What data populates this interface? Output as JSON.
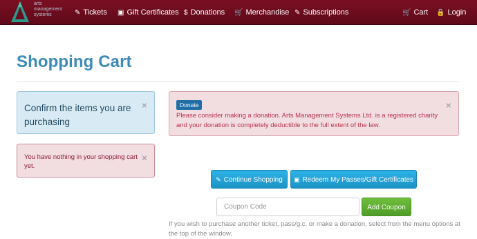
{
  "logo": {
    "alt": "Arts Management Systems",
    "lines": [
      "arts",
      "management",
      "systems"
    ]
  },
  "nav": {
    "items": [
      {
        "label": "Tickets",
        "icon": "ticket-icon"
      },
      {
        "label": "Gift Certificates",
        "icon": "gift-icon"
      },
      {
        "label": "Donations",
        "icon": "dollar-icon"
      },
      {
        "label": "Merchandise",
        "icon": "cart-icon"
      },
      {
        "label": "Subscriptions",
        "icon": "ticket-icon"
      }
    ],
    "cart_label": "Cart",
    "login_label": "Login"
  },
  "page_title": "Shopping Cart",
  "alerts": {
    "confirm": "Confirm the items you are purchasing",
    "empty_cart": "You have nothing in your shopping cart yet.",
    "donate_badge": "Donate",
    "donate_message": "Please consider making a donation. Arts Management Systems Ltd. is a registered charity and your donation is completely deductible to the full extent of the law.",
    "close_symbol": "×"
  },
  "actions": {
    "continue_label": "Continue Shopping",
    "redeem_label": "Redeem My Passes/Gift Certificates",
    "coupon_placeholder": "Coupon Code",
    "add_coupon_label": "Add Coupon"
  },
  "footer_note": "If you wish to purchase another ticket, pass/g.c. or make a donation, select from the menu options at the top of the window.",
  "colors": {
    "navbar": "#6a0c1e",
    "title": "#3c8ab8",
    "button_blue": "#1fa3da",
    "button_green": "#5faf31"
  }
}
